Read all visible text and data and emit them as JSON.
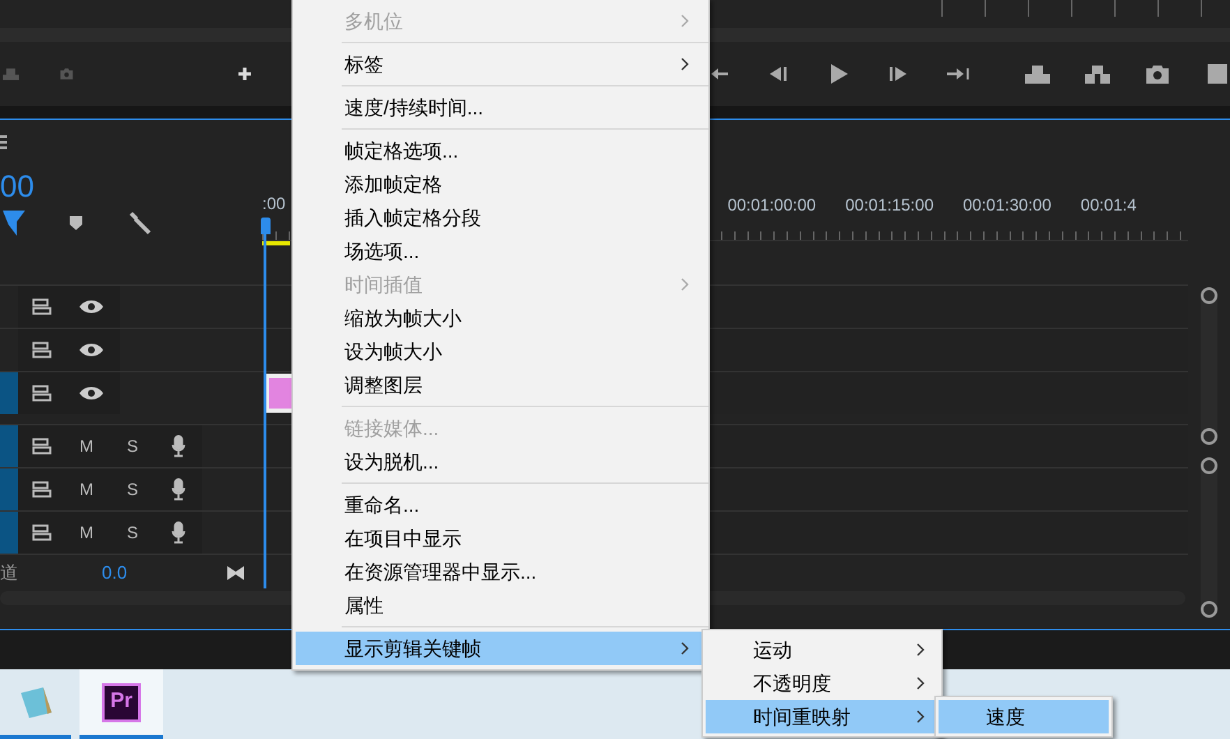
{
  "timeline": {
    "timecode": "00",
    "ruler_start": ":00",
    "ruler_labels": [
      "00:01:00:00",
      "00:01:15:00",
      "00:01:30:00",
      "00:01:4"
    ],
    "tracks": [
      {
        "kind": "video",
        "targeted": false
      },
      {
        "kind": "video",
        "targeted": false
      },
      {
        "kind": "video",
        "targeted": true,
        "has_clip": true
      },
      {
        "kind": "audio",
        "targeted": true,
        "mute": "M",
        "solo": "S"
      },
      {
        "kind": "audio",
        "targeted": true,
        "mute": "M",
        "solo": "S"
      },
      {
        "kind": "audio",
        "targeted": true,
        "mute": "M",
        "solo": "S"
      }
    ],
    "mix": {
      "label": "道",
      "value": "0.0"
    }
  },
  "context_menu": {
    "items": [
      {
        "kind": "item",
        "label": "多机位",
        "disabled": true,
        "submenu": true,
        "selected": false
      },
      {
        "kind": "separator"
      },
      {
        "kind": "item",
        "label": "标签",
        "disabled": false,
        "submenu": true,
        "selected": false
      },
      {
        "kind": "separator"
      },
      {
        "kind": "item",
        "label": "速度/持续时间...",
        "disabled": false,
        "submenu": false,
        "selected": false
      },
      {
        "kind": "separator"
      },
      {
        "kind": "item",
        "label": "帧定格选项...",
        "disabled": false,
        "submenu": false,
        "selected": false
      },
      {
        "kind": "item",
        "label": "添加帧定格",
        "disabled": false,
        "submenu": false,
        "selected": false
      },
      {
        "kind": "item",
        "label": "插入帧定格分段",
        "disabled": false,
        "submenu": false,
        "selected": false
      },
      {
        "kind": "item",
        "label": "场选项...",
        "disabled": false,
        "submenu": false,
        "selected": false
      },
      {
        "kind": "item",
        "label": "时间插值",
        "disabled": true,
        "submenu": true,
        "selected": false
      },
      {
        "kind": "item",
        "label": "缩放为帧大小",
        "disabled": false,
        "submenu": false,
        "selected": false
      },
      {
        "kind": "item",
        "label": "设为帧大小",
        "disabled": false,
        "submenu": false,
        "selected": false
      },
      {
        "kind": "item",
        "label": "调整图层",
        "disabled": false,
        "submenu": false,
        "selected": false
      },
      {
        "kind": "separator"
      },
      {
        "kind": "item",
        "label": "链接媒体...",
        "disabled": true,
        "submenu": false,
        "selected": false
      },
      {
        "kind": "item",
        "label": "设为脱机...",
        "disabled": false,
        "submenu": false,
        "selected": false
      },
      {
        "kind": "separator"
      },
      {
        "kind": "item",
        "label": "重命名...",
        "disabled": false,
        "submenu": false,
        "selected": false
      },
      {
        "kind": "item",
        "label": "在项目中显示",
        "disabled": false,
        "submenu": false,
        "selected": false
      },
      {
        "kind": "item",
        "label": "在资源管理器中显示...",
        "disabled": false,
        "submenu": false,
        "selected": false
      },
      {
        "kind": "item",
        "label": "属性",
        "disabled": false,
        "submenu": false,
        "selected": false
      },
      {
        "kind": "separator"
      },
      {
        "kind": "item",
        "label": "显示剪辑关键帧",
        "disabled": false,
        "submenu": true,
        "selected": true
      }
    ]
  },
  "submenu": {
    "items": [
      {
        "label": "运动",
        "submenu": true,
        "selected": false
      },
      {
        "label": "不透明度",
        "submenu": true,
        "selected": false
      },
      {
        "label": "时间重映射",
        "submenu": true,
        "selected": true
      }
    ]
  },
  "submenu_2": {
    "items": [
      {
        "label": "速度",
        "selected": true
      }
    ]
  },
  "taskbar": {
    "apps": [
      {
        "kind": "notepad",
        "selected": false
      },
      {
        "kind": "premiere",
        "label": "Pr",
        "selected": true
      }
    ]
  }
}
